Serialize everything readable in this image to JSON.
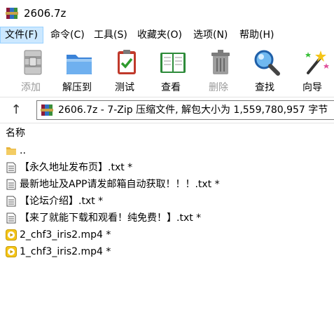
{
  "window": {
    "title": "2606.7z"
  },
  "menu": [
    "文件(F)",
    "命令(C)",
    "工具(S)",
    "收藏夹(O)",
    "选项(N)",
    "帮助(H)"
  ],
  "toolbar": {
    "add": "添加",
    "extract_to": "解压到",
    "test": "测试",
    "view": "查看",
    "delete": "删除",
    "find": "查找",
    "wizard": "向导"
  },
  "address": {
    "text": "2606.7z - 7-Zip 压缩文件, 解包大小为 1,559,780,957 字节"
  },
  "list": {
    "column_name": "名称",
    "items": [
      {
        "name": "..",
        "type": "folder"
      },
      {
        "name": "【永久地址发布页】.txt *",
        "type": "txt"
      },
      {
        "name": "最新地址及APP请发邮箱自动获取！！！.txt *",
        "type": "txt"
      },
      {
        "name": "【论坛介绍】.txt *",
        "type": "txt"
      },
      {
        "name": "【来了就能下载和观看！纯免费！】.txt *",
        "type": "txt"
      },
      {
        "name": "2_chf3_iris2.mp4 *",
        "type": "video"
      },
      {
        "name": "1_chf3_iris2.mp4 *",
        "type": "video"
      }
    ]
  },
  "colors": {
    "menu_highlight": "#cce8ff",
    "video_icon": "#f5c518",
    "folder_icon": "#e8b53e"
  }
}
